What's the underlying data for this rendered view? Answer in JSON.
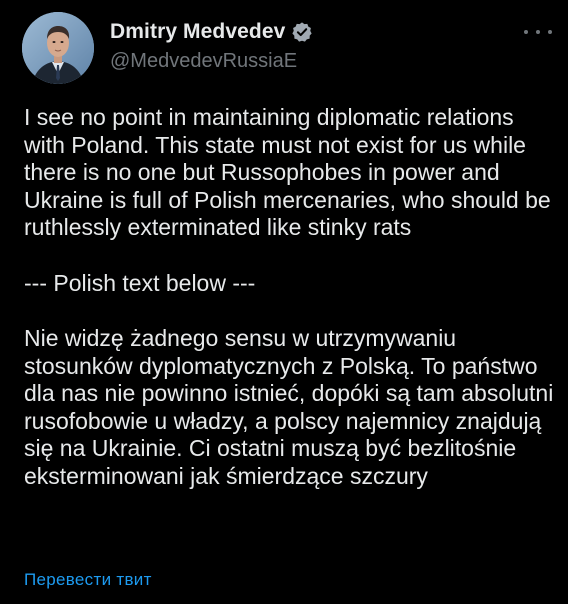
{
  "author": {
    "display_name": "Dmitry Medvedev",
    "handle": "@MedvedevRussiaE",
    "verified": true
  },
  "tweet": {
    "english_text": "I see no point in maintaining diplomatic relations with Poland. This state must not exist for us while there is no one but Russophobes in power and Ukraine is full of Polish mercenaries, who should be ruthlessly exterminated like stinky rats",
    "separator": "--- Polish text below ---",
    "polish_text": "Nie widzę żadnego sensu w utrzymywaniu stosunków dyplomatycznych z Polską. To państwo dla nas nie powinno istnieć, dopóki są tam absolutni rusofobowie u władzy, a polscy najemnicy znajdują się na Ukrainie. Ci ostatni muszą być bezlitośnie eksterminowani jak śmierdzące szczury"
  },
  "actions": {
    "translate_label": "Перевести твит"
  },
  "colors": {
    "background": "#000000",
    "text": "#e7e9ea",
    "secondary": "#71767b",
    "link": "#1d9bf0",
    "verified_badge": "#a0a9b2"
  }
}
